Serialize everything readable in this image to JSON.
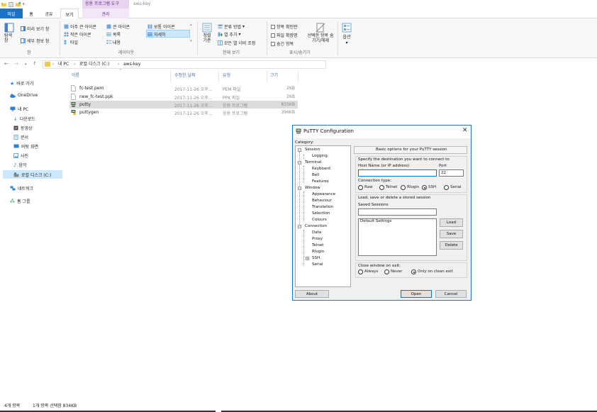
{
  "titlebar": {
    "context_group": "응용 프로그램 도구",
    "title": "aws-key"
  },
  "tabs": {
    "file": "파일",
    "home": "홈",
    "share": "공유",
    "view": "보기",
    "manage": "관리"
  },
  "ribbon": {
    "pane": {
      "nav_pane": "탐색 창",
      "preview": "미리 보기 창",
      "details": "세부 정보 창",
      "label": "창"
    },
    "layout": {
      "extra_large": "아주 큰 아이콘",
      "large": "큰 아이콘",
      "medium": "보통 아이콘",
      "small": "작은 아이콘",
      "list": "목록",
      "details": "자세히",
      "tiles": "타일",
      "content": "내용",
      "label": "레이아웃"
    },
    "current_view": {
      "sort": "정렬 기준",
      "group_by": "분류 방법",
      "add_column": "열 추가",
      "fit_columns": "모든 열 너비 조정",
      "label": "현재 보기"
    },
    "show_hide": {
      "item_checkbox": "항목 확인란",
      "file_ext": "파일 확장명",
      "hidden_items": "숨긴 항목",
      "hide_selected": "선택한 항목 숨기기/해제",
      "label": "표시/숨기기"
    },
    "options": "옵션"
  },
  "address": {
    "crumbs": [
      "내 PC",
      "로컬 디스크 (C:)",
      "aws-key"
    ]
  },
  "nav": {
    "quick_access": "바로 가기",
    "onedrive": "OneDrive",
    "this_pc": "내 PC",
    "downloads": "다운로드",
    "videos": "동영상",
    "documents": "문서",
    "desktop": "바탕 화면",
    "pictures": "사진",
    "music": "음악",
    "local_disk": "로컬 디스크 (C:)",
    "network": "네트워크",
    "homegroup": "홈 그룹"
  },
  "columns": {
    "name": "이름",
    "date": "수정한 날짜",
    "type": "유형",
    "size": "크기"
  },
  "files": [
    {
      "name": "fc-test.pem",
      "date": "2017-11-26 오후...",
      "type": "PEM 파일",
      "size": "2KB"
    },
    {
      "name": "new_fc-test.ppk",
      "date": "2017-11-26 오후...",
      "type": "PPK 파일",
      "size": "2KB"
    },
    {
      "name": "putty",
      "date": "2017-11-26 오후...",
      "type": "응용 프로그램",
      "size": "835KB"
    },
    {
      "name": "puttygen",
      "date": "2017-11-26 오후...",
      "type": "응용 프로그램",
      "size": "396KB"
    }
  ],
  "status": {
    "count": "4개 항목",
    "selection": "1개 항목 선택함 834KB"
  },
  "putty": {
    "title": "PuTTY Configuration",
    "category_label": "Category:",
    "tree": {
      "session": "Session",
      "logging": "Logging",
      "terminal": "Terminal",
      "keyboard": "Keyboard",
      "bell": "Bell",
      "features": "Features",
      "window": "Window",
      "appearance": "Appearance",
      "behaviour": "Behaviour",
      "translation": "Translation",
      "selection": "Selection",
      "colours": "Colours",
      "connection": "Connection",
      "data": "Data",
      "proxy": "Proxy",
      "telnet": "Telnet",
      "rlogin": "Rlogin",
      "ssh": "SSH",
      "serial": "Serial"
    },
    "header": "Basic options for your PuTTY session",
    "dest_label": "Specify the destination you want to connect to",
    "host_label": "Host Name (or IP address)",
    "host_value": "",
    "port_label": "Port",
    "port_value": "22",
    "conn_type_label": "Connection type:",
    "conn_types": [
      "Raw",
      "Telnet",
      "Rlogin",
      "SSH",
      "Serial"
    ],
    "conn_type_selected": "SSH",
    "load_label": "Load, save or delete a stored session",
    "saved_label": "Saved Sessions",
    "saved_value": "",
    "sessions": [
      "Default Settings"
    ],
    "btn_load": "Load",
    "btn_save": "Save",
    "btn_delete": "Delete",
    "close_label": "Close window on exit:",
    "close_options": [
      "Always",
      "Never",
      "Only on clean exit"
    ],
    "close_selected": "Only on clean exit",
    "btn_about": "About",
    "btn_open": "Open",
    "btn_cancel": "Cancel"
  },
  "colors": {
    "file_tab": "#1a73c8",
    "context_tab": "#e6d4f1",
    "selection": "#cce8ff",
    "window_border": "#1979ca"
  }
}
